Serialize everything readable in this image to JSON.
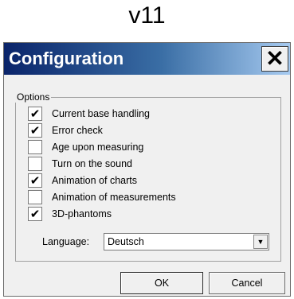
{
  "header": {
    "version": "v11"
  },
  "dialog": {
    "title": "Configuration",
    "close_icon": "close-icon",
    "group_label": "Options",
    "options": [
      {
        "label": "Current base handling",
        "checked": true
      },
      {
        "label": "Error check",
        "checked": true
      },
      {
        "label": "Age upon measuring",
        "checked": false
      },
      {
        "label": "Turn on the sound",
        "checked": false
      },
      {
        "label": "Animation of charts",
        "checked": true
      },
      {
        "label": "Animation of measurements",
        "checked": false
      },
      {
        "label": "3D-phantoms",
        "checked": true
      }
    ],
    "language_label": "Language:",
    "language_value": "Deutsch",
    "ok_label": "OK",
    "cancel_label": "Cancel"
  },
  "colors": {
    "titlebar_start": "#0a246a",
    "titlebar_end": "#a6caf0",
    "dialog_bg": "#f0f0f0"
  }
}
